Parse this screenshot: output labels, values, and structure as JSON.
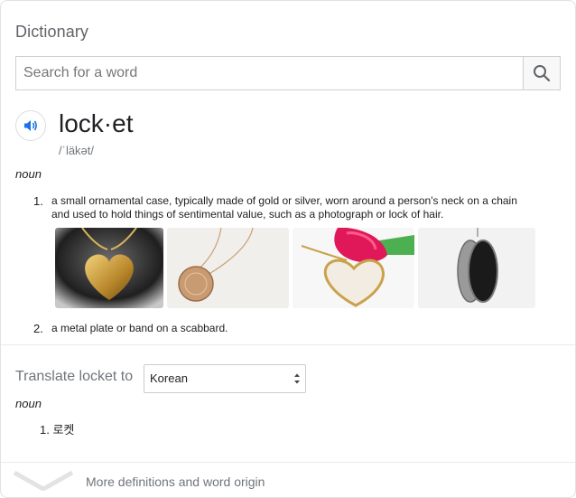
{
  "header": {
    "title": "Dictionary"
  },
  "search": {
    "placeholder": "Search for a word",
    "value": "",
    "button_icon": "search-icon"
  },
  "entry": {
    "headword": "lock·et",
    "phonetic": "/ˈläkət/",
    "part_of_speech": "noun",
    "definitions": [
      {
        "number": "1.",
        "line1": "a small ornamental case, typically made of gold or silver, worn around a person's neck on a chain",
        "line2": "and used to hold things of sentimental value, such as a photograph or lock of hair."
      },
      {
        "number": "2.",
        "line1": "a metal plate or band on a scabbard.",
        "line2": ""
      }
    ],
    "images": [
      {
        "name": "gold-heart-locket-image"
      },
      {
        "name": "round-locket-on-chain-image"
      },
      {
        "name": "heart-locket-with-rose-image"
      },
      {
        "name": "open-silver-locket-image"
      }
    ]
  },
  "translate": {
    "label": "Translate locket to",
    "selected_language": "Korean",
    "part_of_speech": "noun",
    "items": [
      {
        "number": "1.",
        "text": "로켓"
      }
    ]
  },
  "footer": {
    "more_label": "More definitions and word origin"
  },
  "colors": {
    "accent": "#1a73e8",
    "muted": "#70757a",
    "border": "#dfe1e5"
  }
}
